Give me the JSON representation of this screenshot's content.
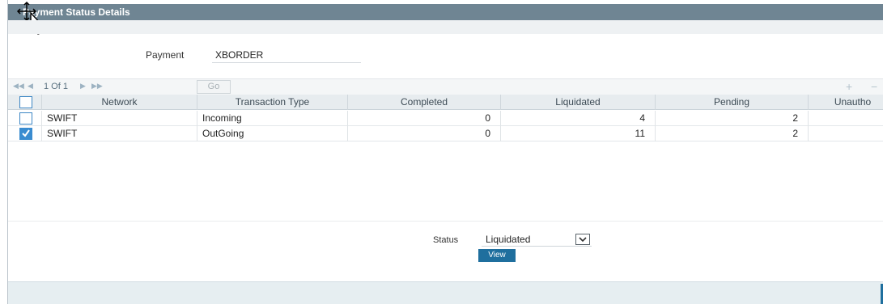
{
  "window": {
    "title": "Payment Status Details"
  },
  "header": {
    "payment_label": "Payment",
    "payment_value": "XBORDER"
  },
  "pager": {
    "first_icon": "first-page-icon",
    "prev_icon": "previous-page-icon",
    "page_info": "1 Of 1",
    "next_icon": "next-page-icon",
    "last_icon": "last-page-icon",
    "go_label": "Go",
    "add_icon": "plus-icon",
    "remove_icon": "minus-icon"
  },
  "table": {
    "columns": [
      "Network",
      "Transaction Type",
      "Completed",
      "Liquidated",
      "Pending",
      "Unautho"
    ],
    "rows": [
      {
        "checked": false,
        "network": "SWIFT",
        "transaction_type": "Incoming",
        "completed": "0",
        "liquidated": "4",
        "pending": "2",
        "unauthorized": ""
      },
      {
        "checked": true,
        "network": "SWIFT",
        "transaction_type": "OutGoing",
        "completed": "0",
        "liquidated": "11",
        "pending": "2",
        "unauthorized": ""
      }
    ]
  },
  "status": {
    "label": "Status",
    "selected": "Liquidated",
    "view_label": "View"
  },
  "colors": {
    "titlebar": "#6f8593",
    "accent": "#1f6f9e",
    "checkbox": "#3a8cd0"
  }
}
